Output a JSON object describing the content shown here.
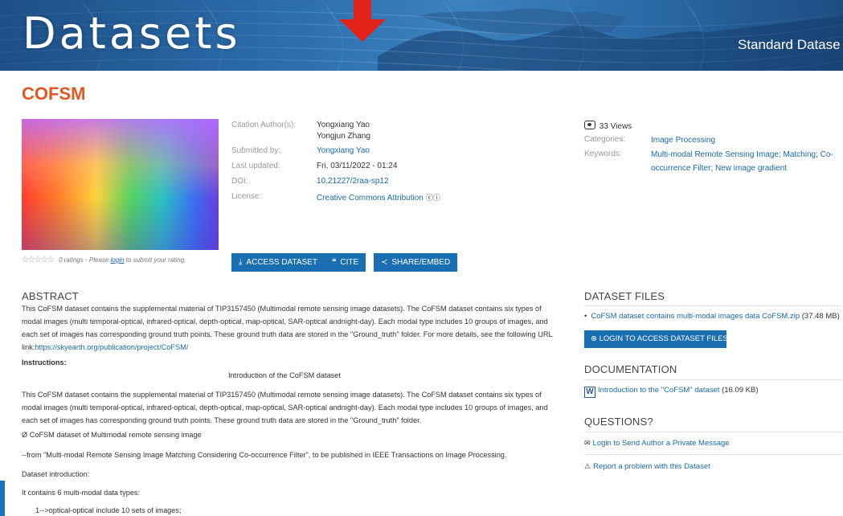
{
  "banner": {
    "title": "Datasets",
    "subtitle": "Standard Datase"
  },
  "dataset": {
    "title": "COFSM"
  },
  "rating": {
    "stars": "☆☆☆☆☆",
    "text_before": "0 ratings - Please",
    "link": "login",
    "text_after": "to submit your rating."
  },
  "meta": {
    "citation_label": "Citation Author(s):",
    "author1": "Yongxiang Yao",
    "author2": "Yongjun Zhang",
    "submitted_label": "Submitted by:",
    "submitted_value": "Yongxiang Yao",
    "updated_label": "Last updated:",
    "updated_value": "Fri, 03/11/2022 - 01:24",
    "doi_label": "DOI:",
    "doi_value": "10.21227/2raa-sp12",
    "license_label": "License:",
    "license_value": "Creative Commons Attribution",
    "license_icons": "ⓒⓘ"
  },
  "side_meta": {
    "views": "33 Views",
    "categories_label": "Categories:",
    "categories_value": "Image Processing",
    "keywords_label": "Keywords:",
    "keywords_value": "Multi-modal Remote Sensing Image; Matching; Co-occurrence Filter; New image gradient"
  },
  "buttons": {
    "access": "ACCESS DATASET",
    "cite": "CITE",
    "share": "SHARE/EMBED"
  },
  "abstract": {
    "heading": "ABSTRACT",
    "body": "This CoFSM dataset contains the supplemental material of TIP3157450 (Multimodal remote sensing image datasets). The CoFSM dataset contains six types of modal images (multi temporal-optical, infrared-optical, depth-optical, map-optical, SAR-optical andnight-day). Each modal type includes 10 groups of images, and each set of images has corresponding ground truth points. These ground truth data are stored in the \"Ground_truth\" folder. For more details, see the following URL link:",
    "link": "https://skyearth.org/publication/project/CoFSM/"
  },
  "instructions": {
    "heading": "Instructions:",
    "intro_title": "Introduction of the CoFSM dataset",
    "body": "This CoFSM dataset contains the supplemental material of TIP3157450 (Multimodal remote sensing image datasets). The CoFSM dataset contains six types of modal images (multi temporal-optical, infrared-optical, depth-optical, map-optical, SAR-optical andnight-day). Each modal type includes 10 groups of images, and each set of images has corresponding ground truth points. These ground truth data are stored in the \"Ground_truth\" folder.",
    "line1": "Ø  CoFSM dataset of Multimodal remote sensing image",
    "line2": "--from \"Multi-modal Remote Sensing Image Matching Considering Co-occurrence Filter\", to be published in IEEE Transactions on Image Processing.",
    "line3": "Dataset introduction:",
    "line4": "It contains 6 multi-modal data types:",
    "line5": "1-->optical-optical include 10 sets of images;"
  },
  "files": {
    "heading": "DATASET FILES",
    "item": "CoFSM dataset contains multi-modal images data CoFSM.zip",
    "size": "(37.48 MB)",
    "login_button": "LOGIN TO ACCESS DATASET FILES"
  },
  "documentation": {
    "heading": "DOCUMENTATION",
    "item": "Introduction to the \"CoFSM\" dataset",
    "size": "(16.09 KB)"
  },
  "questions": {
    "heading": "QUESTIONS?",
    "item1": "Login to Send Author a Private Message",
    "item2": "Report a problem with this Dataset"
  }
}
